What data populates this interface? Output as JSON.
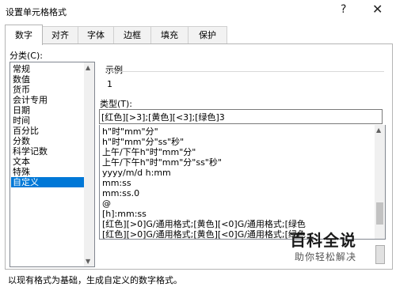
{
  "window": {
    "title": "设置单元格格式",
    "help": "?",
    "close": "✕"
  },
  "tabs": [
    "数字",
    "对齐",
    "字体",
    "边框",
    "填充",
    "保护"
  ],
  "category": {
    "label": "分类(C):",
    "items": [
      "常规",
      "数值",
      "货币",
      "会计专用",
      "日期",
      "时间",
      "百分比",
      "分数",
      "科学记数",
      "文本",
      "特殊",
      "自定义"
    ],
    "selected": "自定义"
  },
  "example": {
    "label": "示例",
    "value": "1"
  },
  "type": {
    "label": "类型(T):",
    "value": "[红色][>3];[黄色][<3];[绿色]3",
    "formats": [
      "h\"时\"mm\"分\"",
      "h\"时\"mm\"分\"ss\"秒\"",
      "上午/下午h\"时\"mm\"分\"",
      "上午/下午h\"时\"mm\"分\"ss\"秒\"",
      "yyyy/m/d h:mm",
      "mm:ss",
      "mm:ss.0",
      "@",
      "[h]:mm:ss",
      "[红色][>0]G/通用格式;[黄色][<0]G/通用格式;[绿色",
      "[红色][>0]G/通用格式;[黄色][<0]G/通用格式;[绿色"
    ]
  },
  "watermark": {
    "brand": "百科全说",
    "slogan": "助你轻松解决"
  },
  "description": "以现有格式为基础，生成自定义的数字格式。"
}
